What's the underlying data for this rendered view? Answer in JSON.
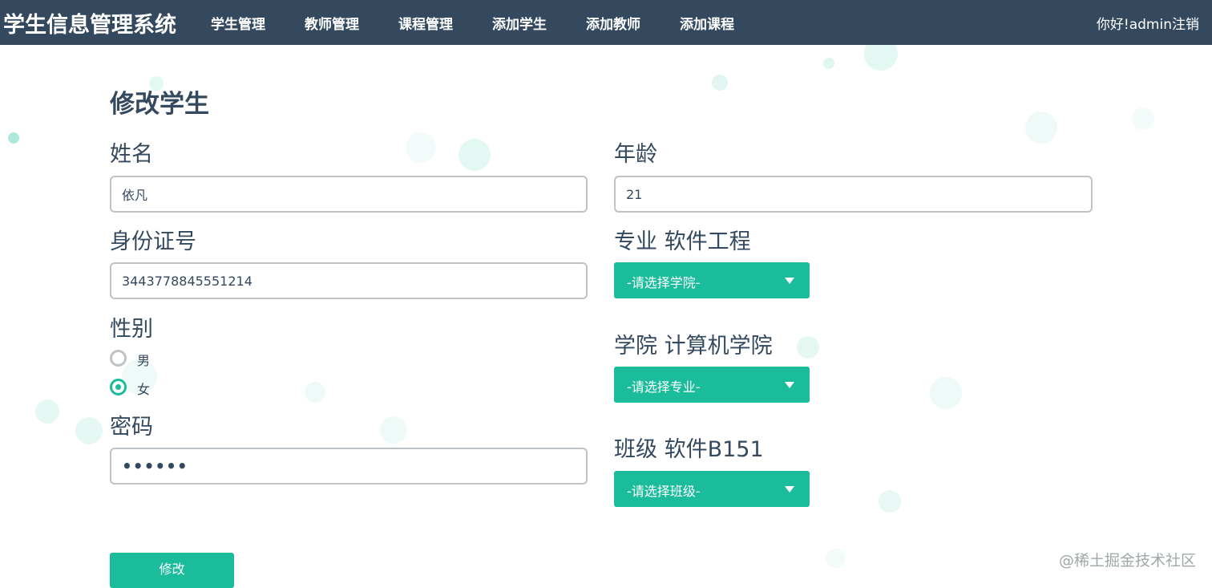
{
  "header": {
    "brand": "学生信息管理系统",
    "nav": [
      "学生管理",
      "教师管理",
      "课程管理",
      "添加学生",
      "添加教师",
      "添加课程"
    ],
    "greeting": "你好!admin",
    "logout": "注销"
  },
  "form": {
    "title": "修改学生",
    "name_label": "姓名",
    "name_value": "依凡",
    "age_label": "年龄",
    "age_value": "21",
    "id_label": "身份证号",
    "id_value": "3443778845551214",
    "gender_label": "性别",
    "gender_options": [
      "男",
      "女"
    ],
    "gender_selected": "女",
    "password_label": "密码",
    "password_value": "••••••",
    "major_label": "专业 软件工程",
    "major_select": "-请选择学院-",
    "college_label": "学院 计算机学院",
    "college_select": "-请选择专业-",
    "class_label": "班级 软件B151",
    "class_select": "-请选择班级-",
    "submit_label": "修改"
  },
  "watermark": "@稀土掘金技术社区",
  "colors": {
    "header_bg": "#34495e",
    "accent": "#1abc9c",
    "border": "#bdc3c7"
  }
}
